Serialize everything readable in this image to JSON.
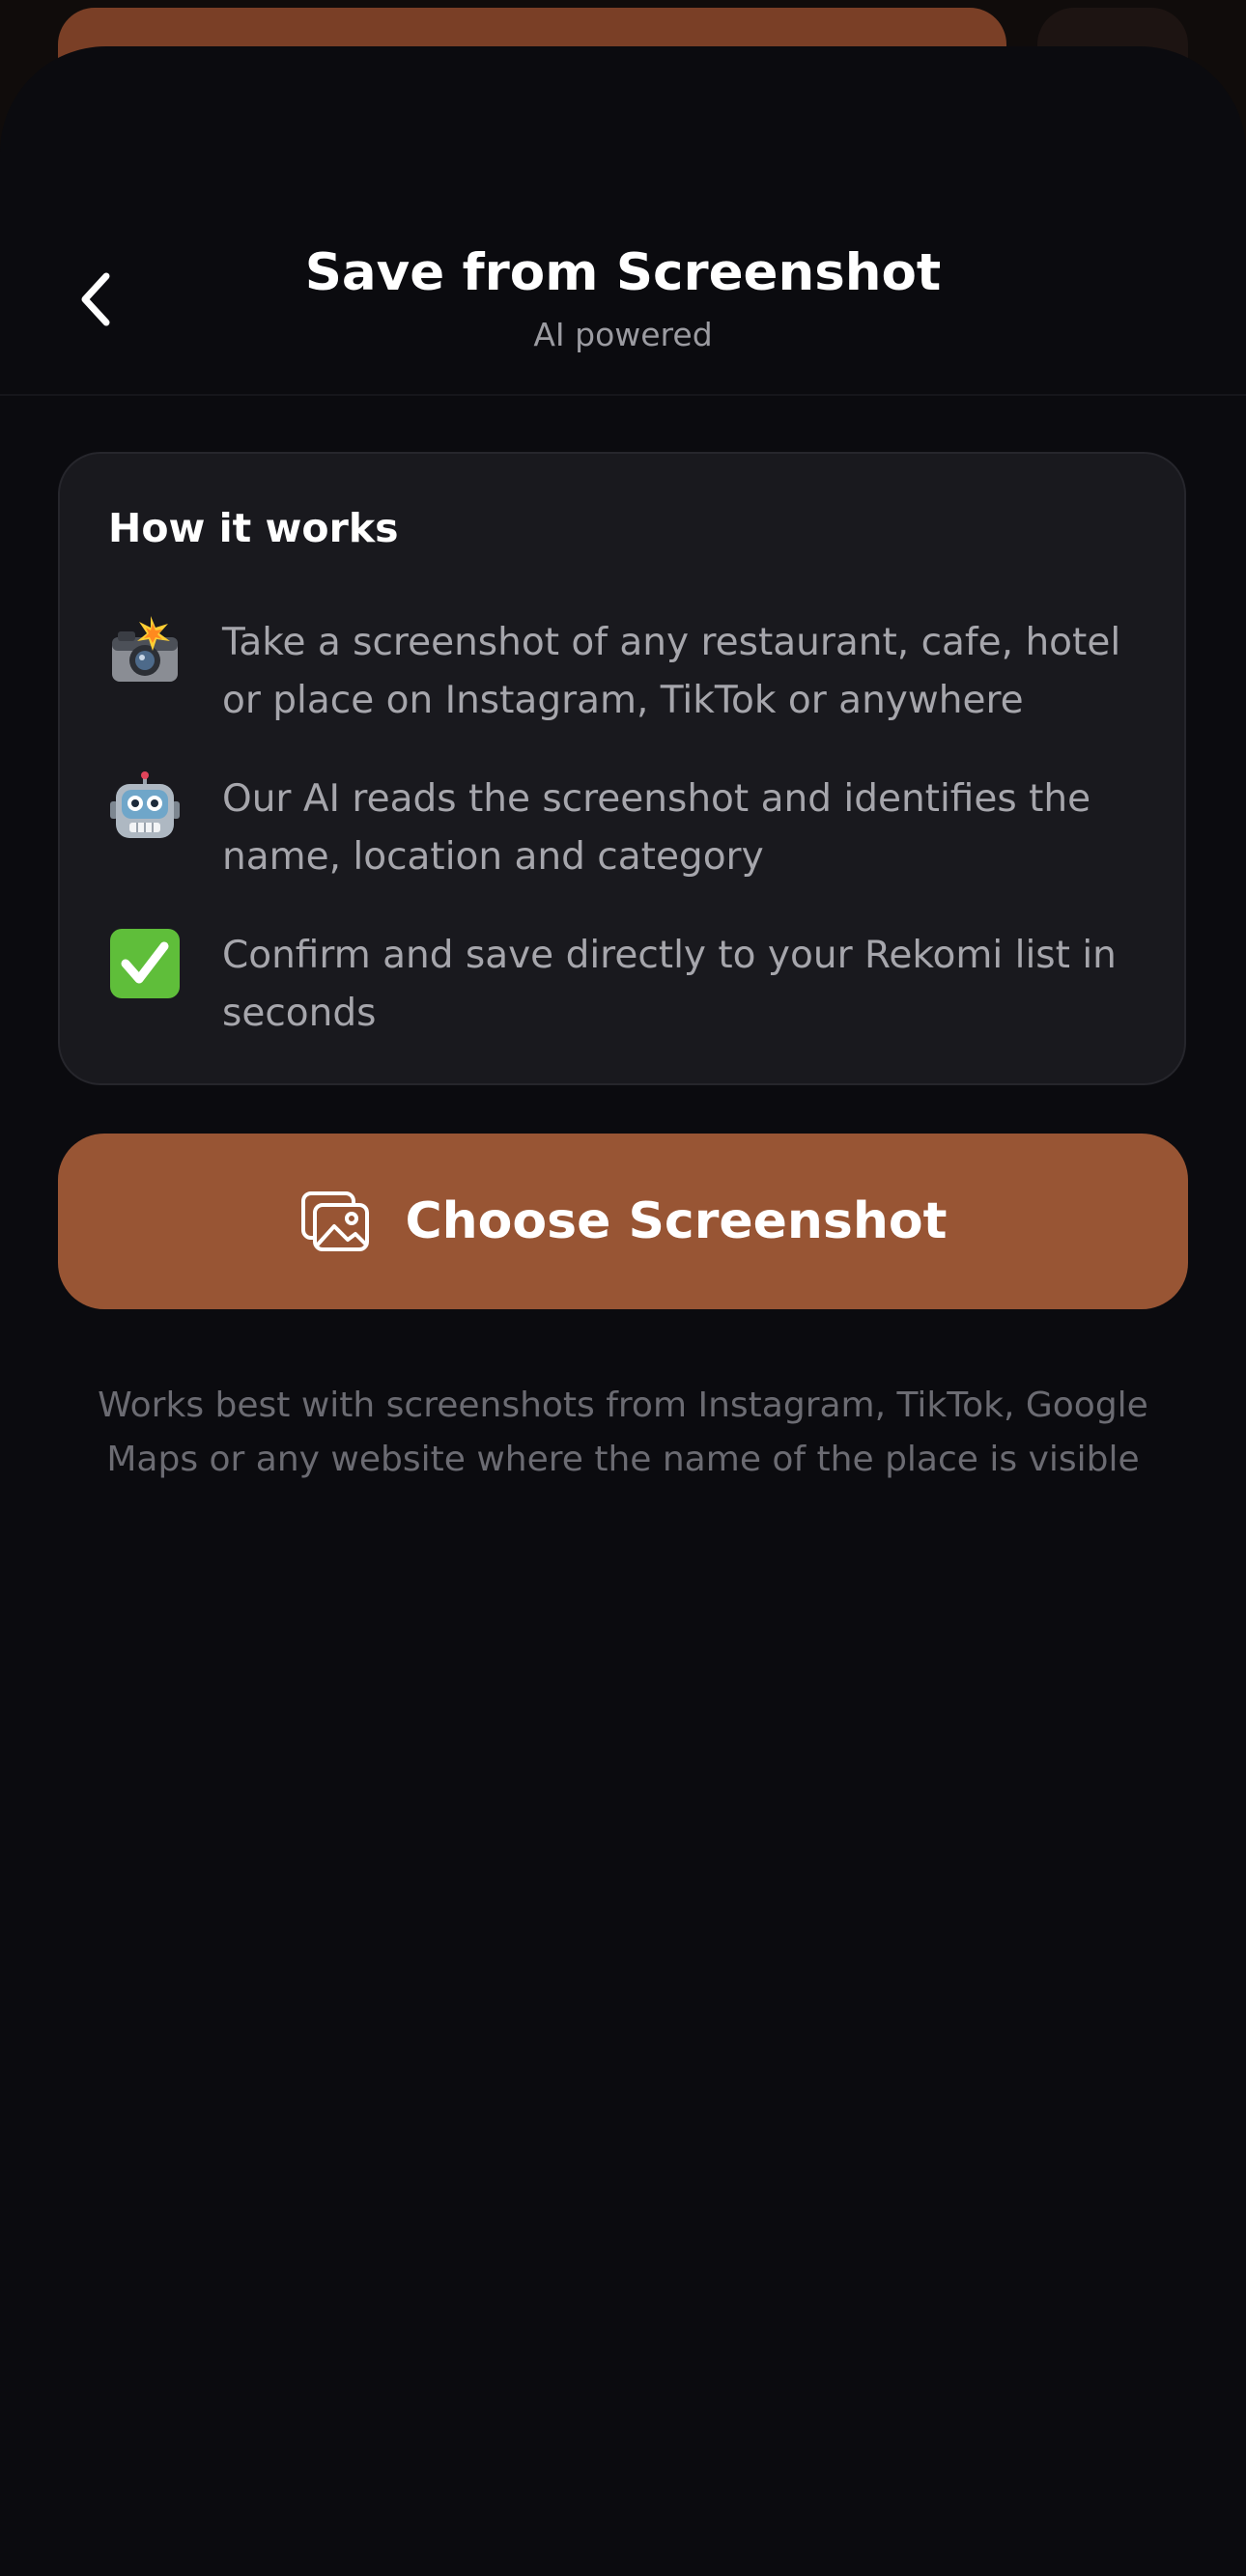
{
  "header": {
    "title": "Save from Screenshot",
    "subtitle": "AI powered",
    "back_icon": "chevron-left-icon"
  },
  "how_it_works": {
    "title": "How it works",
    "steps": [
      {
        "icon": "camera-flash-icon",
        "text": "Take a screenshot of any restaurant, cafe, hotel or place on Instagram, TikTok or anywhere"
      },
      {
        "icon": "robot-icon",
        "text": "Our AI reads the screenshot and identifies the name, location and category"
      },
      {
        "icon": "check-mark-icon",
        "text": "Confirm and save directly to your Rekomi list in seconds"
      }
    ]
  },
  "action": {
    "button_label": "Choose Screenshot",
    "button_icon": "images-icon"
  },
  "hint": "Works best with screenshots from Instagram, TikTok, Google Maps or any website where the name of the place is visible",
  "colors": {
    "accent": "#985534",
    "background": "#0b0b0f",
    "card": "#19191e",
    "check_green": "#5fbe3a"
  }
}
